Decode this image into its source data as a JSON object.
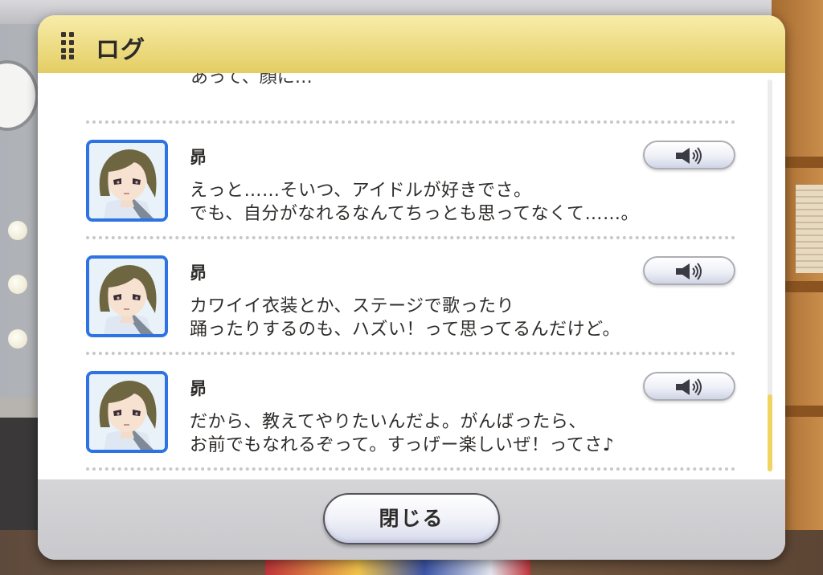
{
  "panel": {
    "title": "ログ",
    "partial_previous_line": "あって、顔に…",
    "close_label": "閉じる"
  },
  "entries": [
    {
      "speaker": "昴",
      "lines": [
        "えっと……そいつ、アイドルが好きでさ。",
        "でも、自分がなれるなんてちっとも思ってなくて……。"
      ],
      "voice_icon": "speaker-icon"
    },
    {
      "speaker": "昴",
      "lines": [
        "カワイイ衣装とか、ステージで歌ったり",
        "踊ったりするのも、ハズい！って思ってるんだけど。"
      ],
      "voice_icon": "speaker-icon"
    },
    {
      "speaker": "昴",
      "lines": [
        "だから、教えてやりたいんだよ。がんばったら、",
        "お前でもなれるぞって。すっげー楽しいぜ！ってさ♪"
      ],
      "voice_icon": "speaker-icon"
    }
  ],
  "scroll": {
    "position_fraction": 0.8
  },
  "colors": {
    "header": "#efdf8a",
    "portrait_border": "#2d73e3",
    "scroll_thumb": "#f0d45f"
  }
}
